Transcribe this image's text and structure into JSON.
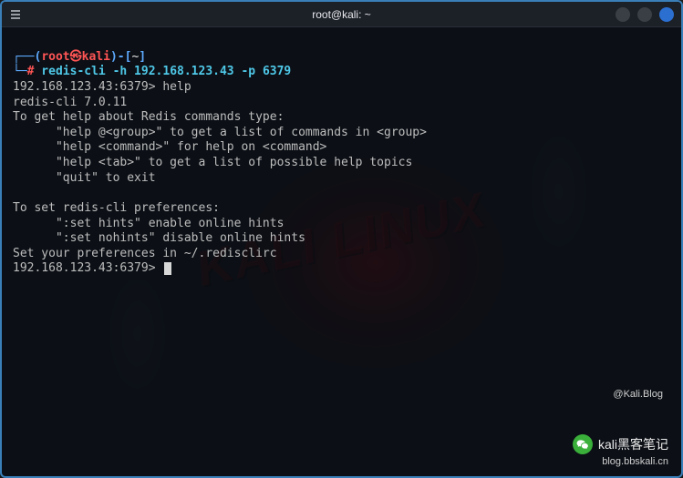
{
  "titlebar": {
    "title": "root@kali: ~"
  },
  "prompt": {
    "open": "┌──(",
    "user": "root",
    "sep": "㉿",
    "host": "kali",
    "close": ")-[",
    "path": "~",
    "end": "]",
    "line2_lead": "└─",
    "hash": "#",
    "command": " redis-cli -h 192.168.123.43 -p 6379"
  },
  "out": {
    "l1": "192.168.123.43:6379> help",
    "l2": "redis-cli 7.0.11",
    "l3": "To get help about Redis commands type:",
    "l4": "      \"help @<group>\" to get a list of commands in <group>",
    "l5": "      \"help <command>\" for help on <command>",
    "l6": "      \"help <tab>\" to get a list of possible help topics",
    "l7": "      \"quit\" to exit",
    "l8": "",
    "l9": "To set redis-cli preferences:",
    "l10": "      \":set hints\" enable online hints",
    "l11": "      \":set nohints\" disable online hints",
    "l12": "Set your preferences in ~/.redisclirc",
    "l13": "192.168.123.43:6379> "
  },
  "watermark": {
    "top": "@Kali.Blog",
    "name": "kali黑客笔记",
    "sub": "blog.bbskali.cn"
  }
}
